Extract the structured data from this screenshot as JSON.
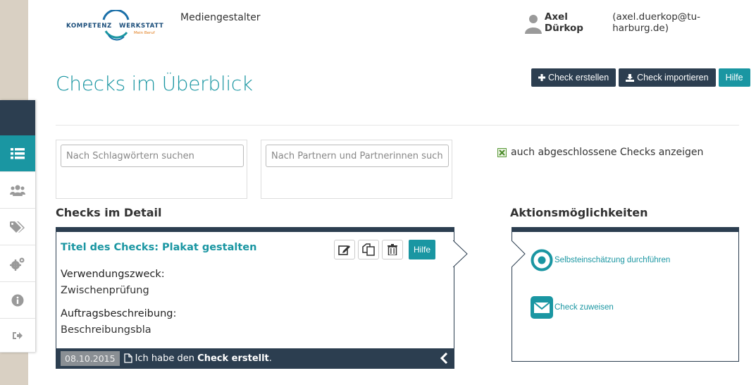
{
  "header": {
    "logo_text": "KOMPETENZ WERKSTATT",
    "logo_sub": "Mein Beruf",
    "brand_title": "Mediengestalter",
    "user_name": "Axel Dürkop",
    "user_email": "(axel.duerkop@tu-harburg.de)"
  },
  "sidebar": {
    "items": [
      {
        "icon": "list-icon",
        "active": true
      },
      {
        "icon": "users-icon"
      },
      {
        "icon": "tags-icon"
      },
      {
        "icon": "cogs-icon"
      },
      {
        "icon": "info-icon"
      },
      {
        "icon": "logout-icon"
      }
    ]
  },
  "page": {
    "title": "Checks im Überblick"
  },
  "toolbar": {
    "create_label": "Check erstellen",
    "import_label": "Check importieren",
    "help_label": "Hilfe"
  },
  "filters": {
    "keyword_placeholder": "Nach Schlagwörtern suchen",
    "partner_placeholder": "Nach Partnern und Partnerinnen suchen",
    "show_completed_label": "auch abgeschlossene Checks anzeigen",
    "show_completed_checked": true
  },
  "detail": {
    "heading": "Checks im Detail",
    "title": "Titel des Checks: Plakat gestalten",
    "help_label": "Hilfe",
    "purpose_label": "Verwendungszweck:",
    "purpose_value": "Zwischenprüfung",
    "description_label": "Auftragsbeschreibung:",
    "description_value": "Beschreibungsbla",
    "footer_date": "08.10.2015",
    "footer_text_pre": "Ich habe den",
    "footer_text_bold": "Check erstellt",
    "footer_text_post": "."
  },
  "actions": {
    "heading": "Aktionsmöglichkeiten",
    "self_assessment_label": "Selbsteinschätzung durchführen",
    "assign_label": "Check zuweisen"
  },
  "colors": {
    "teal": "#1a96a2",
    "dark": "#2c3e50",
    "sidebar_bg": "#d9d0c3"
  }
}
